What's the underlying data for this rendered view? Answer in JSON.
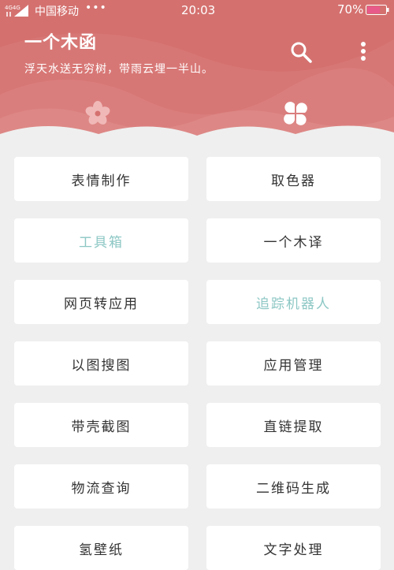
{
  "status_bar": {
    "network": "4G4G",
    "carrier": "中国移动",
    "dots": "•••",
    "time": "20:03",
    "battery_percent": "70%",
    "battery_level": 0.7
  },
  "header": {
    "title": "一个木函",
    "subtitle": "浮天水送无穷树，带雨云埋一半山。"
  },
  "tabs": [
    {
      "icon": "flower-icon"
    },
    {
      "icon": "clover-grid-icon"
    }
  ],
  "tools": [
    {
      "label": "表情制作",
      "muted": false
    },
    {
      "label": "取色器",
      "muted": false
    },
    {
      "label": "工具箱",
      "muted": true
    },
    {
      "label": "一个木译",
      "muted": false
    },
    {
      "label": "网页转应用",
      "muted": false
    },
    {
      "label": "追踪机器人",
      "muted": true
    },
    {
      "label": "以图搜图",
      "muted": false
    },
    {
      "label": "应用管理",
      "muted": false
    },
    {
      "label": "带壳截图",
      "muted": false
    },
    {
      "label": "直链提取",
      "muted": false
    },
    {
      "label": "物流查询",
      "muted": false
    },
    {
      "label": "二维码生成",
      "muted": false
    },
    {
      "label": "氢壁纸",
      "muted": false
    },
    {
      "label": "文字处理",
      "muted": false
    }
  ],
  "colors": {
    "header": "#d4716f",
    "background": "#efefef",
    "muted_text": "#8cc7c4"
  }
}
